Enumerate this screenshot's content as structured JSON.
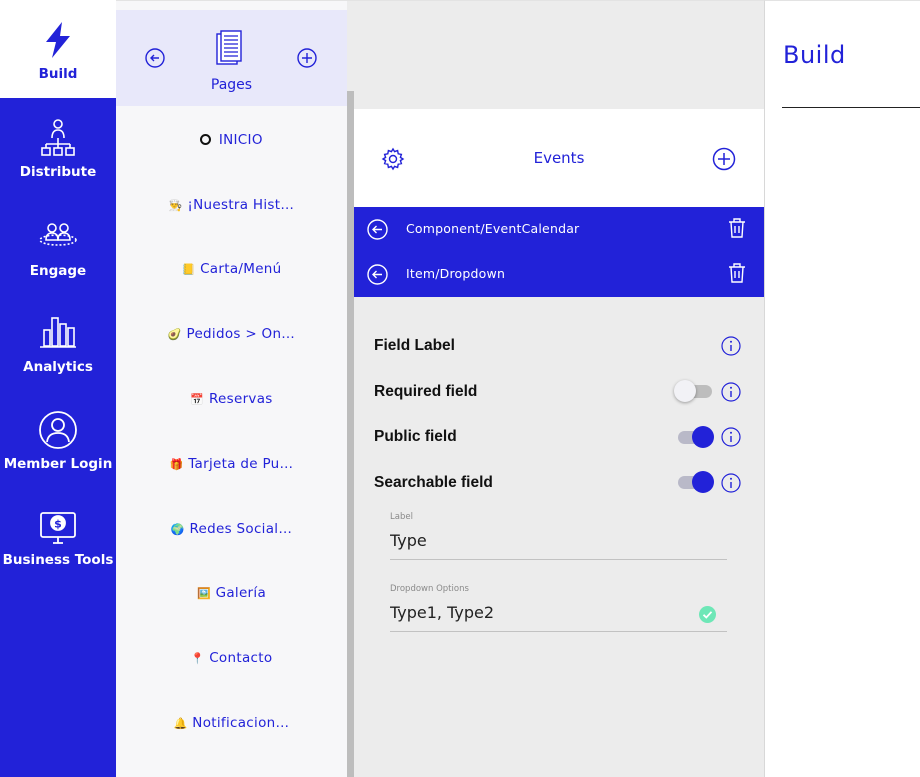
{
  "nav": {
    "items": [
      {
        "label": "Build",
        "icon": "lightning-icon",
        "active": true
      },
      {
        "label": "Distribute",
        "icon": "org-chart-icon"
      },
      {
        "label": "Engage",
        "icon": "people-group-icon"
      },
      {
        "label": "Analytics",
        "icon": "bar-chart-icon"
      },
      {
        "label": "Member Login",
        "icon": "user-circle-icon"
      },
      {
        "label": "Business Tools",
        "icon": "monitor-dollar-icon"
      }
    ]
  },
  "pages": {
    "title": "Pages",
    "items": [
      {
        "emoji": "",
        "label": "INICIO"
      },
      {
        "emoji": "👨‍🍳",
        "label": "¡Nuestra Hist…"
      },
      {
        "emoji": "📒",
        "label": "Carta/Menú"
      },
      {
        "emoji": "🥑",
        "label": "Pedidos > On…"
      },
      {
        "emoji": "📅",
        "label": "Reservas"
      },
      {
        "emoji": "🎁",
        "label": "Tarjeta de Pu…"
      },
      {
        "emoji": "🌍",
        "label": "Redes Social…"
      },
      {
        "emoji": "🖼️",
        "label": "Galería"
      },
      {
        "emoji": "📍",
        "label": "Contacto"
      },
      {
        "emoji": "🔔",
        "label": "Notificacion…"
      }
    ]
  },
  "editor": {
    "events_title": "Events",
    "breadcrumbs": [
      {
        "label": "Component/EventCalendar"
      },
      {
        "label": "Item/Dropdown"
      }
    ],
    "settings": [
      {
        "label": "Field Label",
        "toggle": null
      },
      {
        "label": "Required field",
        "toggle": false
      },
      {
        "label": "Public field",
        "toggle": true
      },
      {
        "label": "Searchable field",
        "toggle": true
      }
    ],
    "fields": [
      {
        "label": "Label",
        "value": "Type"
      },
      {
        "label": "Dropdown Options",
        "value": "Type1, Type2"
      }
    ]
  },
  "preview": {
    "title": "Build"
  },
  "colors": {
    "accent": "#2222d8",
    "check": "#6ee7b7"
  }
}
